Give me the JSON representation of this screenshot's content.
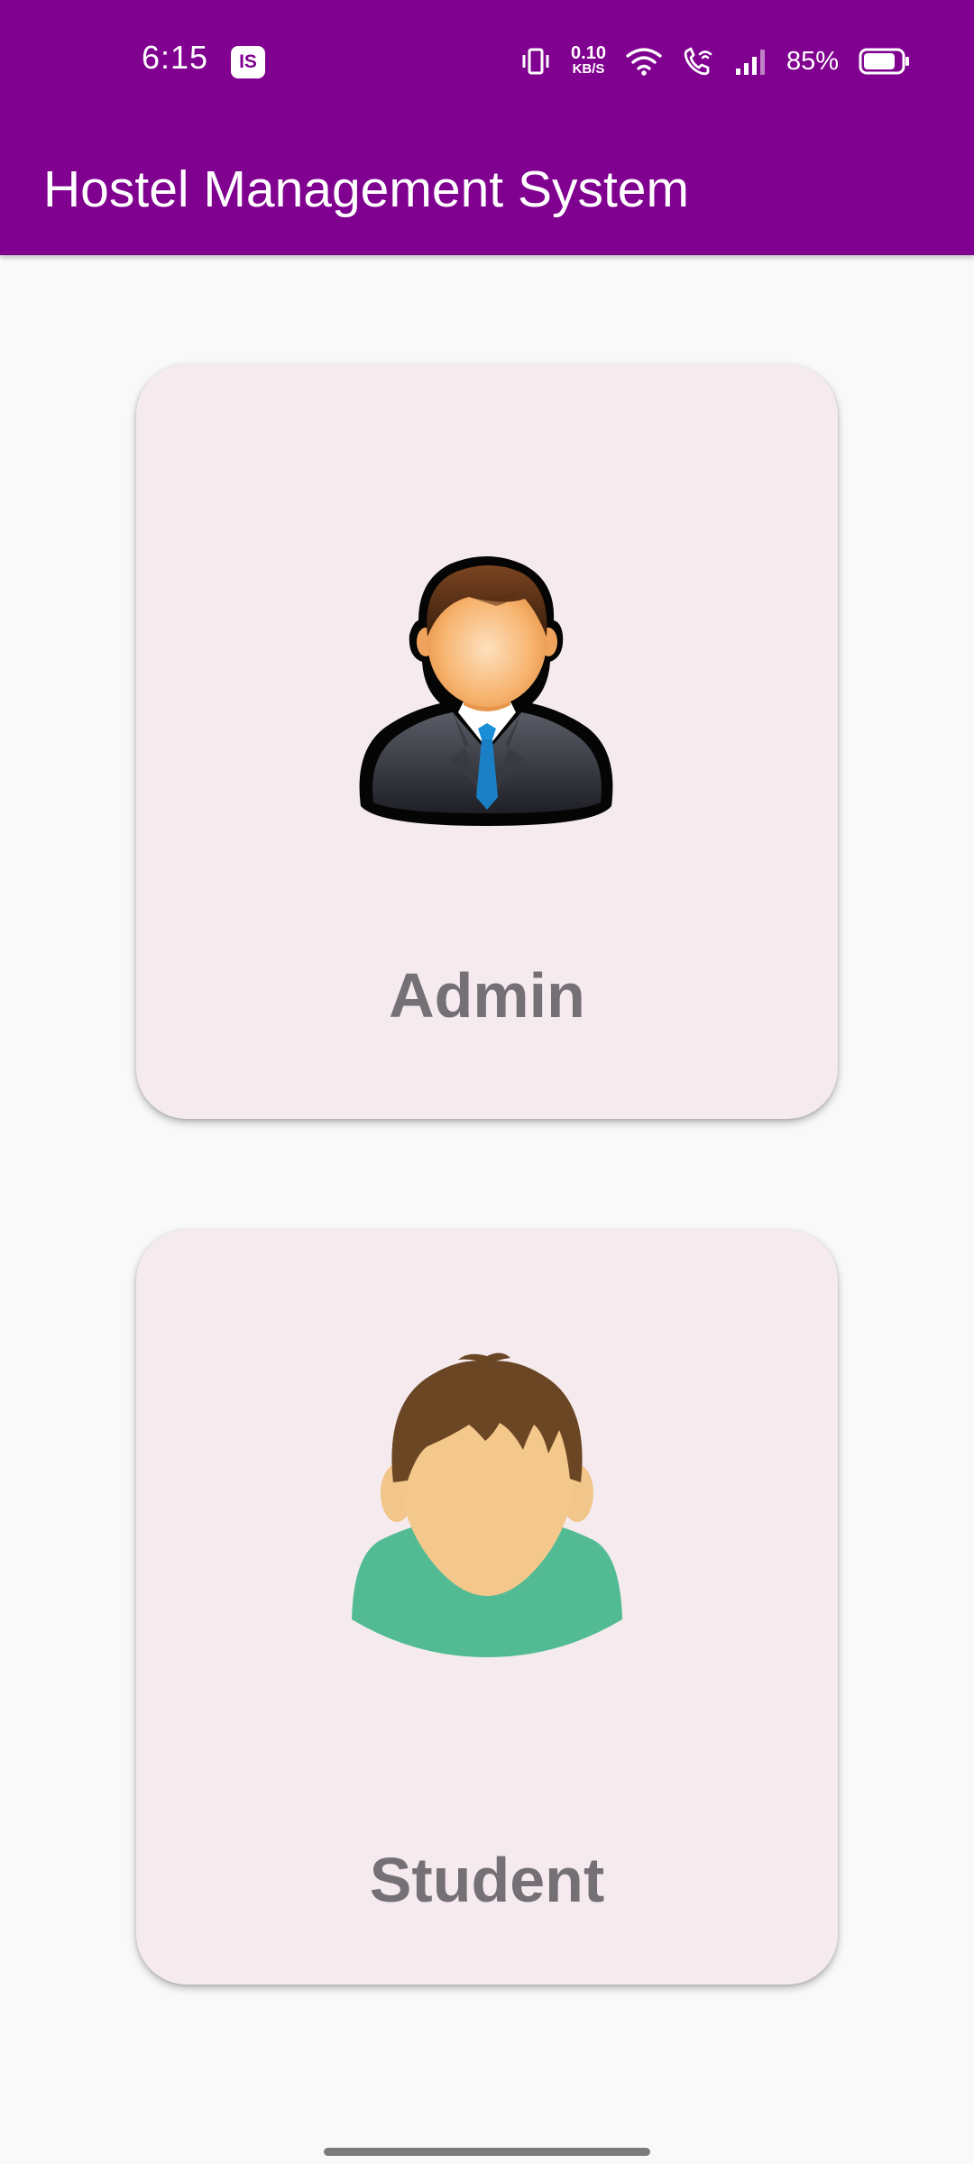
{
  "status_bar": {
    "time": "6:15",
    "badge": "IS",
    "net_speed_value": "0.10",
    "net_speed_unit": "KB/S",
    "battery_percent": "85%",
    "battery_level": 0.85,
    "icons": [
      "vibrate-icon",
      "wifi-icon",
      "wifi-call-icon",
      "signal-icon",
      "battery-icon"
    ]
  },
  "app_bar": {
    "title": "Hostel Management System"
  },
  "roles": [
    {
      "label": "Admin",
      "icon": "admin-avatar-icon"
    },
    {
      "label": "Student",
      "icon": "student-avatar-icon"
    }
  ],
  "colors": {
    "primary": "#800090",
    "card_background": "#f5ebef",
    "label_text": "#757075",
    "page_background": "#f9f9f9"
  }
}
